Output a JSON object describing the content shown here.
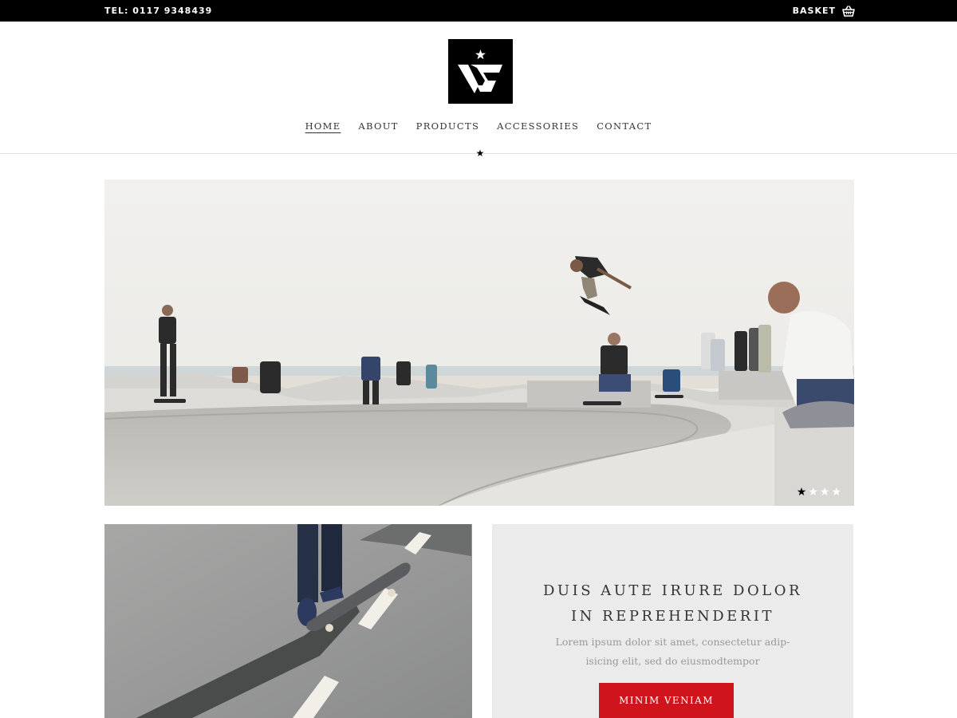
{
  "topbar": {
    "phone": "TEL: 0117 9348439",
    "basket_label": "BASKET",
    "basket_icon": "basket-icon"
  },
  "logo": {
    "icon": "brand-logo-star-v"
  },
  "nav": {
    "items": [
      {
        "label": "HOME",
        "active": true
      },
      {
        "label": "ABOUT",
        "active": false
      },
      {
        "label": "PRODUCTS",
        "active": false
      },
      {
        "label": "ACCESSORIES",
        "active": false
      },
      {
        "label": "CONTACT",
        "active": false
      }
    ],
    "indicator_icon": "star-icon",
    "indicator_glyph": "★"
  },
  "hero": {
    "image": "skatepark-bowl-photo",
    "slides": 4,
    "active_slide": 1,
    "dot_glyph": "★"
  },
  "feature": {
    "image": "skateboard-feet-photo"
  },
  "promo": {
    "title_line1": "DUIS AUTE IRURE DOLOR",
    "title_line2": "IN REPREHENDERIT",
    "text_line1": "Lorem ipsum dolor sit amet, consectetur adip-",
    "text_line2": "isicing elit, sed do eiusmodtempor",
    "button_label": "MINIM VENIAM",
    "button_color": "#d0141c"
  },
  "colors": {
    "topbar_bg": "#000000",
    "promo_bg": "#ebebeb",
    "accent": "#d0141c"
  }
}
